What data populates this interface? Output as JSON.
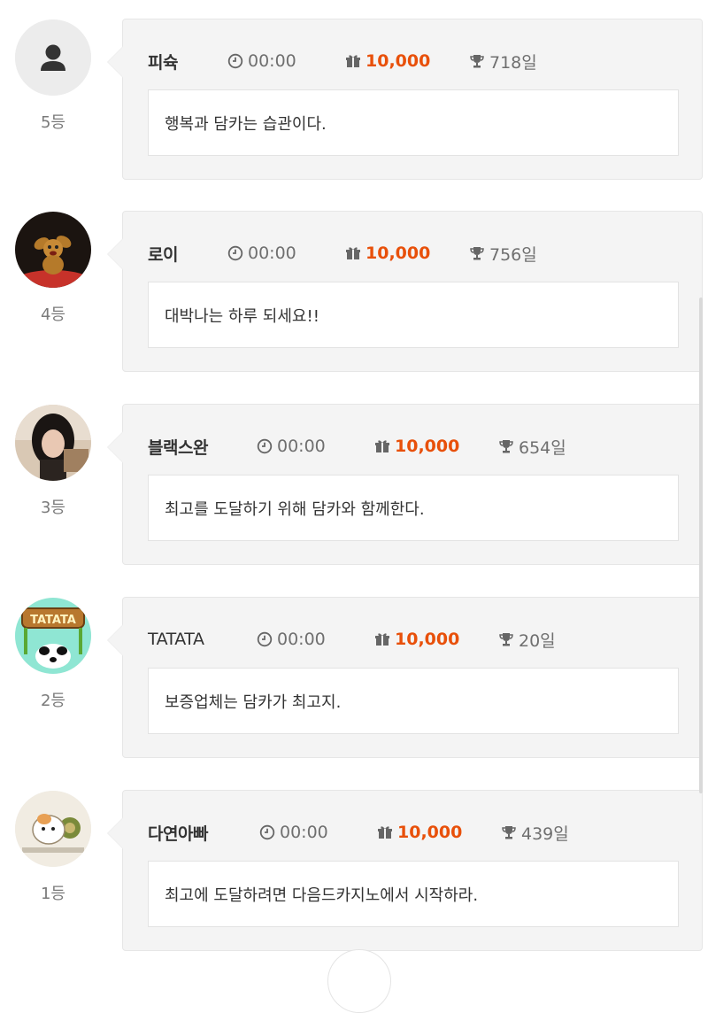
{
  "colors": {
    "reward": "#e8500a",
    "card_bg": "#f4f4f4",
    "message_bg": "#ffffff",
    "muted_text": "#7a7a7a"
  },
  "entries": [
    {
      "rank": "5등",
      "name": "피슉",
      "time": "00:00",
      "reward": "10,000",
      "days": "718일",
      "message": "행복과 담카는 습관이다.",
      "avatar": "default-user-icon"
    },
    {
      "rank": "4등",
      "name": "로이",
      "time": "00:00",
      "reward": "10,000",
      "days": "756일",
      "message": "대박나는 하루 되세요!!",
      "avatar": "cartoon-character-avatar"
    },
    {
      "rank": "3등",
      "name": "블랙스완",
      "time": "00:00",
      "reward": "10,000",
      "days": "654일",
      "message": "최고를 도달하기 위해 담카와 함께한다.",
      "avatar": "person-photo-avatar"
    },
    {
      "rank": "2등",
      "name": "TATATA",
      "time": "00:00",
      "reward": "10,000",
      "days": "20일",
      "message": "보증업체는 담카가 최고지.",
      "avatar": "panda-sign-avatar",
      "avatar_text": "TATATA"
    },
    {
      "rank": "1등",
      "name": "다연아빠",
      "time": "00:00",
      "reward": "10,000",
      "days": "439일",
      "message": "최고에 도달하려면 다음드카지노에서 시작하라.",
      "avatar": "hamster-avatar"
    }
  ],
  "icons": {
    "time": "clock-icon",
    "reward": "gift-icon",
    "days": "trophy-icon"
  }
}
